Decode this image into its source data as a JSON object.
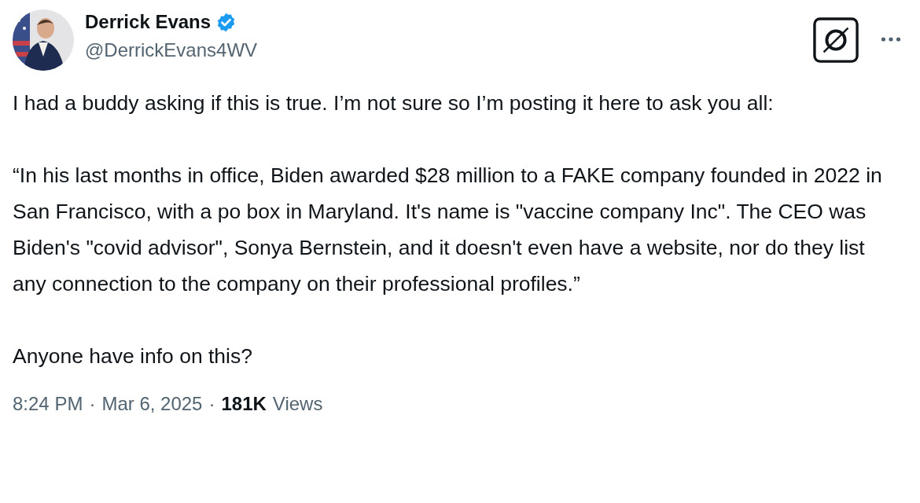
{
  "author": {
    "name": "Derrick Evans",
    "verified": true,
    "handle": "@DerrickEvans4WV"
  },
  "body": [
    "I had a buddy asking if this is true. I’m not sure so I’m posting it here to ask you all:",
    "“In his last months in office, Biden awarded $28 million to a FAKE company founded in 2022 in San Francisco, with a po box in Maryland. It's name is \"vaccine company Inc\". The CEO was Biden's \"covid advisor\", Sonya Bernstein, and it doesn't even have a website, nor do they list any connection to the company on their professional profiles.”",
    "Anyone have info on this?"
  ],
  "meta": [
    {
      "text": "8:24 PM",
      "kind": "plain"
    },
    {
      "text": "·",
      "kind": "plain"
    },
    {
      "text": "Mar 6, 2025",
      "kind": "plain"
    },
    {
      "text": "·",
      "kind": "plain"
    },
    {
      "text": "181K",
      "kind": "strong"
    },
    {
      "text": "Views",
      "kind": "plain"
    }
  ]
}
